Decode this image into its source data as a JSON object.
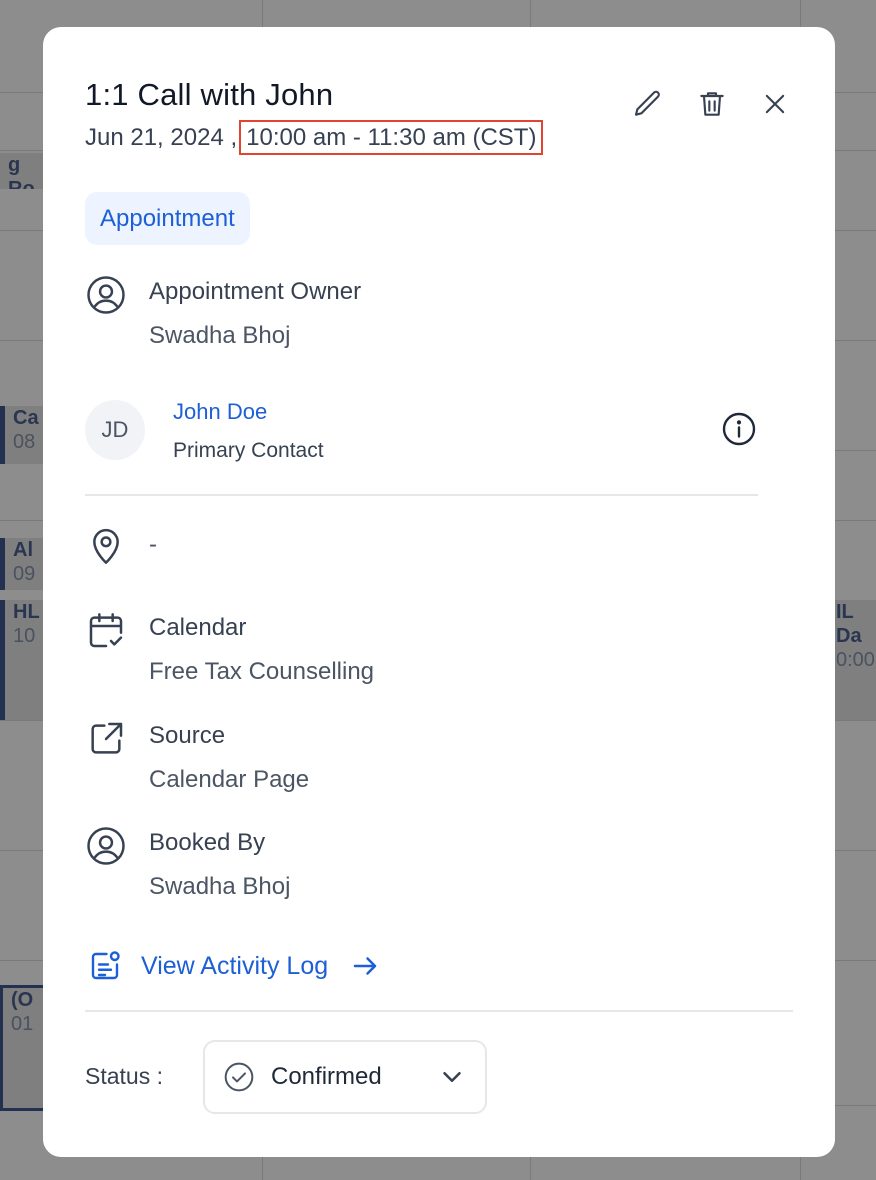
{
  "background": {
    "events": [
      {
        "line1": "g Ro",
        "line2": ""
      },
      {
        "line1": "Ca",
        "line2": "08"
      },
      {
        "line1": "Al",
        "line2": "09"
      },
      {
        "line1": "HL",
        "line2": "10"
      },
      {
        "line1": "IL Da",
        "line2": "0:00"
      },
      {
        "line1": "(O",
        "line2": "01"
      }
    ]
  },
  "appointment": {
    "title": "1:1 Call with John",
    "date": "Jun 21, 2024 ,",
    "time_range": "10:00 am - 11:30 am (CST)",
    "type_badge": "Appointment",
    "owner_label": "Appointment Owner",
    "owner_name": "Swadha Bhoj",
    "contact": {
      "initials": "JD",
      "name": "John Doe",
      "role": "Primary Contact"
    },
    "location": "-",
    "calendar_label": "Calendar",
    "calendar_name": "Free Tax Counselling",
    "source_label": "Source",
    "source_value": "Calendar Page",
    "booked_by_label": "Booked By",
    "booked_by_value": "Swadha Bhoj",
    "activity_log_label": "View Activity Log",
    "status_label": "Status :",
    "status_value": "Confirmed"
  },
  "icons": {
    "edit": "pencil-icon",
    "delete": "trash-icon",
    "close": "close-icon",
    "owner": "user-circle-icon",
    "info": "info-icon",
    "location": "map-pin-icon",
    "calendar": "calendar-check-icon",
    "source": "external-link-icon",
    "booked_by": "user-circle-icon",
    "activity": "activity-log-icon",
    "arrow": "arrow-right-icon",
    "status": "check-circle-icon",
    "chevron": "chevron-down-icon"
  },
  "colors": {
    "accent": "#1d5fd6",
    "badge_bg": "#eef4ff",
    "highlight_border": "#e2452f",
    "overlay": "#8d8d8d"
  }
}
